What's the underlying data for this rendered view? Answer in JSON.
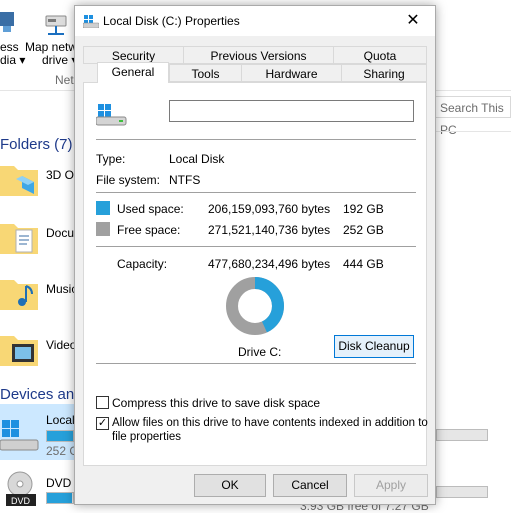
{
  "explorer": {
    "ribbon": {
      "media_label_1": "ess",
      "media_label_2": "dia ▾",
      "map_label_1": "Map netw",
      "map_label_2": "drive ▾",
      "network_group": "Net"
    },
    "search_placeholder": "Search This PC",
    "folders_header": "Folders (7)",
    "folders": [
      "3D Ob",
      "Docu",
      "Music",
      "Video"
    ],
    "devices_header": "Devices and",
    "drives": [
      {
        "name": "Local",
        "free": "252 G",
        "used_fraction": 0.43
      },
      {
        "name": "DVD",
        "free": "3.93 GB free of 7.27 GB",
        "used_fraction": 0.46
      }
    ],
    "dvd_badge": "DVD"
  },
  "dialog": {
    "title": "Local Disk (C:) Properties",
    "close_glyph": "✕",
    "tabs_row1": [
      "Security",
      "Previous Versions",
      "Quota"
    ],
    "tabs_row2": [
      "General",
      "Tools",
      "Hardware",
      "Sharing"
    ],
    "active_tab": "General",
    "drive_name_value": "",
    "type_label": "Type:",
    "type_value": "Local Disk",
    "fs_label": "File system:",
    "fs_value": "NTFS",
    "used_label": "Used space:",
    "used_bytes": "206,159,093,760 bytes",
    "used_gb": "192 GB",
    "free_label": "Free space:",
    "free_bytes": "271,521,140,736 bytes",
    "free_gb": "252 GB",
    "capacity_label": "Capacity:",
    "capacity_bytes": "477,680,234,496 bytes",
    "capacity_gb": "444 GB",
    "drive_caption": "Drive C:",
    "cleanup_button": "Disk Cleanup",
    "compress_label": "Compress this drive to save disk space",
    "compress_checked": false,
    "index_label_1": "Allow files on this drive to have contents indexed in addition to",
    "index_label_2": "file properties",
    "index_checked": true,
    "check_glyph": "✓",
    "ok_button": "OK",
    "cancel_button": "Cancel",
    "apply_button": "Apply",
    "used_color": "#26a0da",
    "free_color": "#a0a0a0",
    "used_fraction": 0.4316
  }
}
